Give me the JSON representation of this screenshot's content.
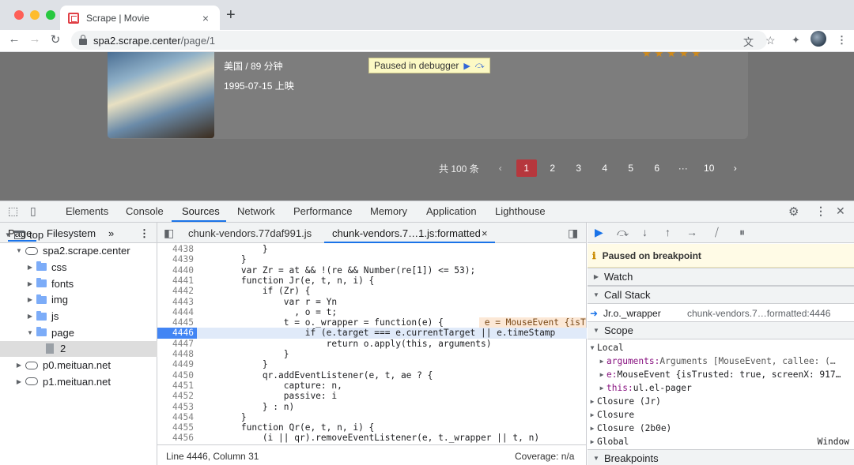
{
  "browser": {
    "tab_title": "Scrape | Movie",
    "tab_close": "×",
    "new_tab": "+",
    "url_host": "spa2.scrape.center",
    "url_path": "/page/1"
  },
  "page": {
    "meta_region_duration": "美国 / 89 分钟",
    "release": "1995-07-15 上映",
    "stars": "★★★★★",
    "debugger_banner": "Paused in debugger",
    "pager": {
      "total": "共 100 条",
      "prev": "‹",
      "next": "›",
      "pages": [
        "1",
        "2",
        "3",
        "4",
        "5",
        "6",
        "···",
        "10"
      ],
      "active_page": "1"
    }
  },
  "devtools": {
    "tabs": [
      "Elements",
      "Console",
      "Sources",
      "Network",
      "Performance",
      "Memory",
      "Application",
      "Lighthouse"
    ],
    "active_tab": "Sources",
    "navigator": {
      "tabs": [
        "Page",
        "Filesystem",
        "»"
      ],
      "tree": [
        {
          "label": "top",
          "kind": "frame",
          "depth": 0,
          "open": true
        },
        {
          "label": "spa2.scrape.center",
          "kind": "cloud",
          "depth": 1,
          "open": true
        },
        {
          "label": "css",
          "kind": "folder",
          "depth": 2,
          "open": false
        },
        {
          "label": "fonts",
          "kind": "folder",
          "depth": 2,
          "open": false
        },
        {
          "label": "img",
          "kind": "folder",
          "depth": 2,
          "open": false
        },
        {
          "label": "js",
          "kind": "folder",
          "depth": 2,
          "open": false
        },
        {
          "label": "page",
          "kind": "folder",
          "depth": 2,
          "open": true
        },
        {
          "label": "2",
          "kind": "file",
          "depth": 3,
          "selected": true
        },
        {
          "label": "p0.meituan.net",
          "kind": "cloud",
          "depth": 1,
          "open": false
        },
        {
          "label": "p1.meituan.net",
          "kind": "cloud",
          "depth": 1,
          "open": false
        }
      ]
    },
    "editor": {
      "tabs": [
        {
          "label": "chunk-vendors.77daf991.js"
        },
        {
          "label": "chunk-vendors.7…1.js:formatted",
          "active": true,
          "close": "×"
        }
      ],
      "lines": [
        {
          "n": "4438",
          "code": "            }"
        },
        {
          "n": "4439",
          "code": "        }"
        },
        {
          "n": "4440",
          "code": "        var Zr = at && !(re && Number(re[1]) <= 53);"
        },
        {
          "n": "4441",
          "code": "        function Jr(e, t, n, i) {"
        },
        {
          "n": "4442",
          "code": "            if (Zr) {"
        },
        {
          "n": "4443",
          "code": "                var r = Yn"
        },
        {
          "n": "4444",
          "code": "                  , o = t;"
        },
        {
          "n": "4445",
          "code": "                t = o._wrapper = function(e) {",
          "inline": " e = MouseEvent {isT"
        },
        {
          "n": "4446",
          "code": "                    if (e.target === e.currentTarget || e.timeStamp",
          "current": true
        },
        {
          "n": "4447",
          "code": "                        return o.apply(this, arguments)"
        },
        {
          "n": "4448",
          "code": "                }"
        },
        {
          "n": "4449",
          "code": "            }"
        },
        {
          "n": "4450",
          "code": "            qr.addEventListener(e, t, ae ? {"
        },
        {
          "n": "4451",
          "code": "                capture: n,"
        },
        {
          "n": "4452",
          "code": "                passive: i"
        },
        {
          "n": "4453",
          "code": "            } : n)"
        },
        {
          "n": "4454",
          "code": "        }"
        },
        {
          "n": "4455",
          "code": "        function Qr(e, t, n, i) {"
        },
        {
          "n": "4456",
          "code": "            (i || qr).removeEventListener(e, t._wrapper || t, n)"
        }
      ],
      "status_position": "Line 4446, Column 31",
      "coverage": "Coverage: n/a"
    },
    "debugger": {
      "banner": "Paused on breakpoint",
      "watch": "Watch",
      "call_stack": "Call Stack",
      "frame_fn": "Jr.o._wrapper",
      "frame_loc": "chunk-vendors.7…formatted:4446",
      "scope": "Scope",
      "local": "Local",
      "scope_rows": [
        {
          "key": "arguments:",
          "val": " Arguments [MouseEvent, callee: (…"
        },
        {
          "key": "e:",
          "val": " MouseEvent {isTrusted: true, screenX: 917…"
        },
        {
          "key": "this:",
          "val": " ul.el-pager"
        }
      ],
      "closures": [
        "Closure (Jr)",
        "Closure",
        "Closure (2b0e)"
      ],
      "global": "Global",
      "global_val": "Window",
      "breakpoints": "Breakpoints"
    }
  },
  "colors": {
    "accent": "#1a73e8",
    "pager_active": "#b6373d",
    "breakpoint_line": "#4285f4"
  }
}
